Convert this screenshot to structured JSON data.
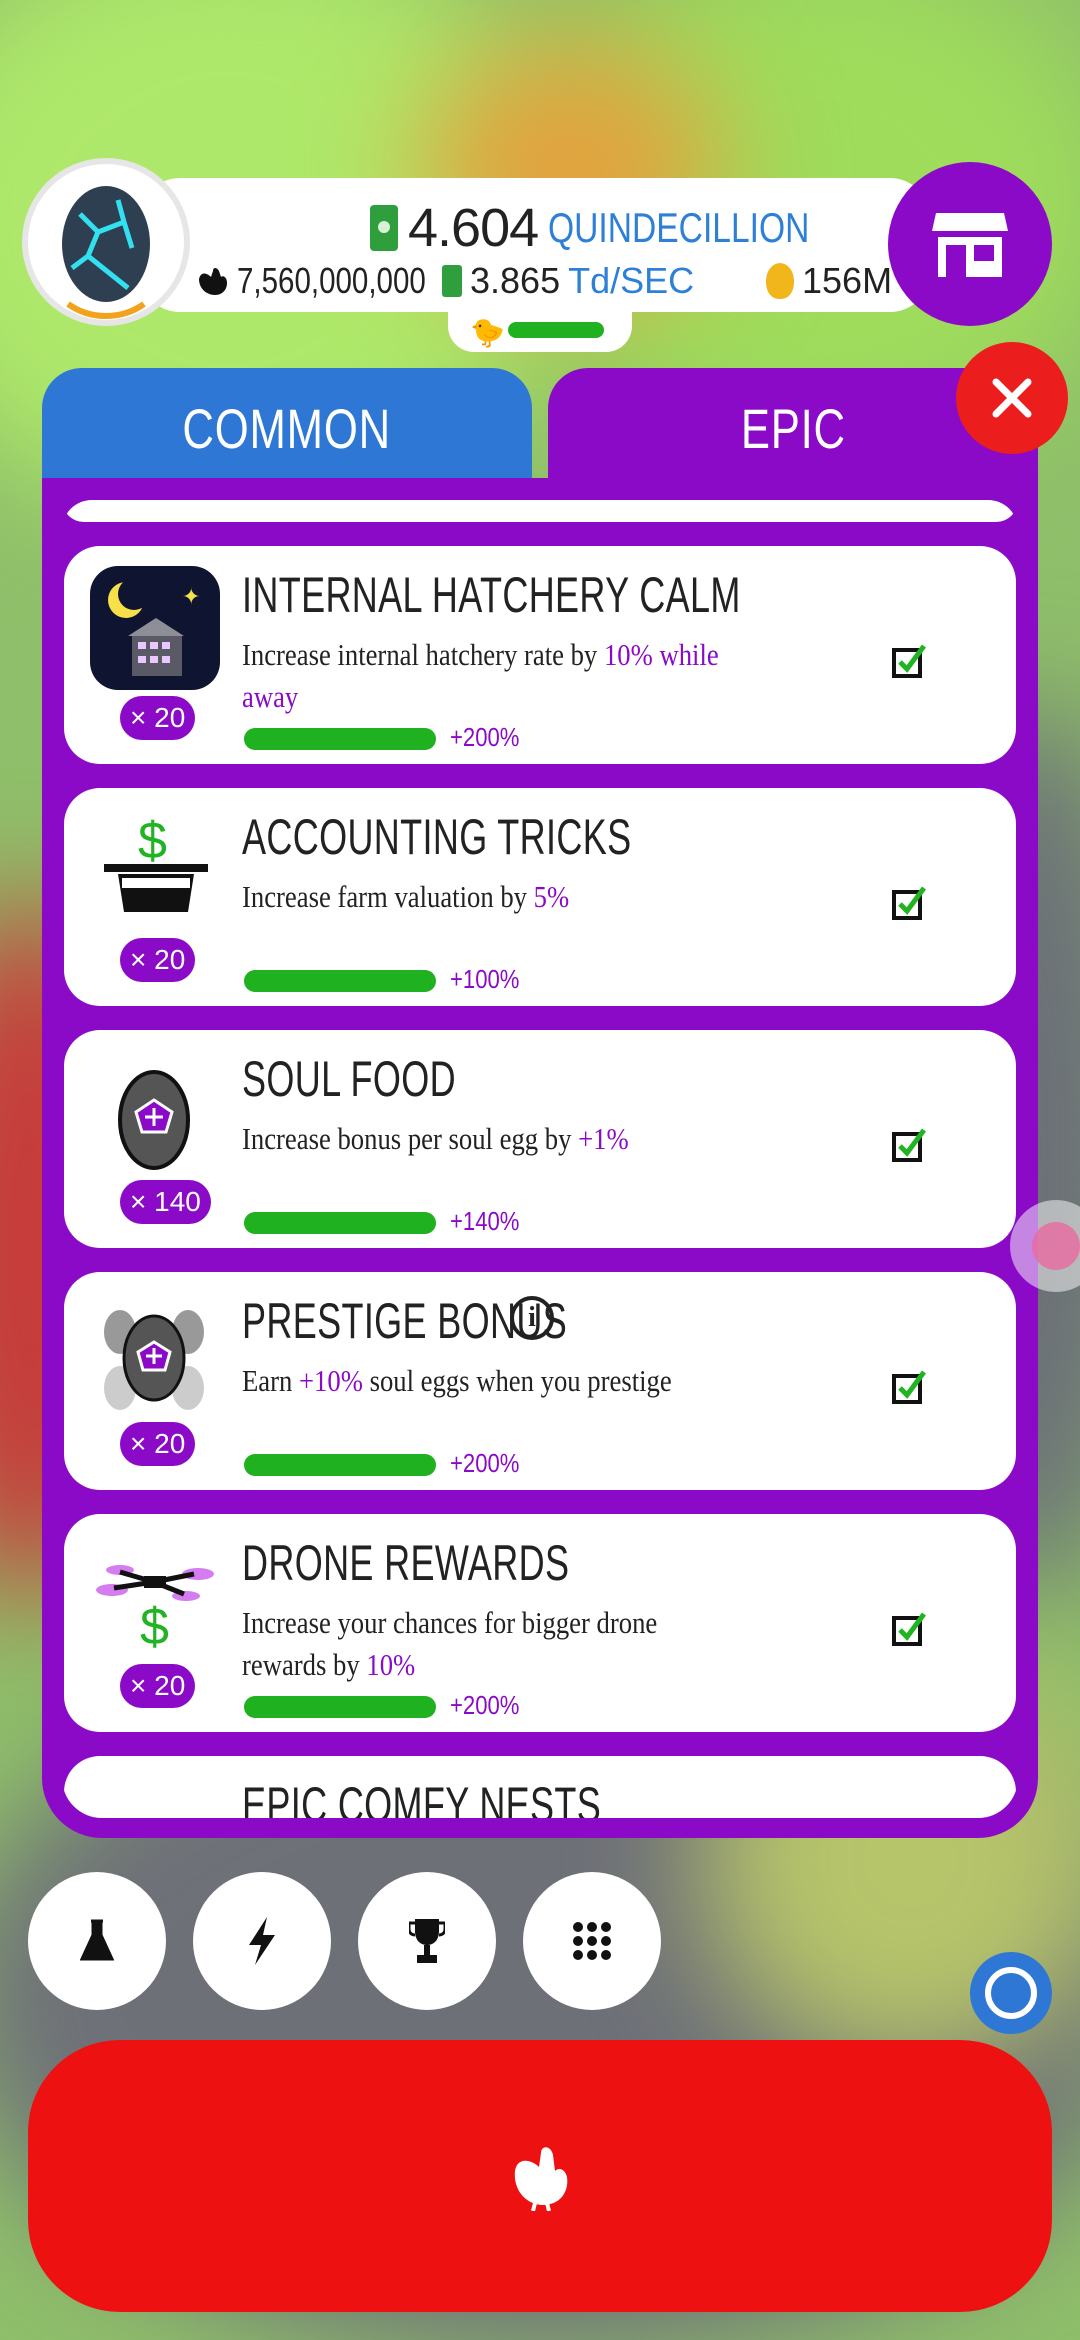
{
  "header": {
    "money_value": "4.604",
    "money_unit": "QUINDECILLION",
    "chicken_count": "7,560,000,000",
    "earning_rate": "3.865",
    "earning_rate_unit": "Td/SEC",
    "golden_eggs": "156M",
    "hatchery_fill": 0.8
  },
  "tabs": [
    {
      "label": "COMMON",
      "color": "#2f77d4"
    },
    {
      "label": "EPIC",
      "color": "#8a0ac7"
    }
  ],
  "research_items": [
    {
      "title": "INTERNAL HATCHERY CALM",
      "desc_prefix": "Increase internal hatchery rate by ",
      "desc_highlight": "10% while away",
      "count": "× 20",
      "bonus": "+200%",
      "purchased": true,
      "icon": "hatchery-night-icon"
    },
    {
      "title": "ACCOUNTING TRICKS",
      "desc_prefix": "Increase farm valuation by ",
      "desc_highlight": "5%",
      "count": "× 20",
      "bonus": "+100%",
      "purchased": true,
      "icon": "top-hat-dollar-icon"
    },
    {
      "title": "SOUL FOOD",
      "desc_prefix": "Increase bonus per soul egg by ",
      "desc_highlight": "+1%",
      "count": "× 140",
      "bonus": "+140%",
      "purchased": true,
      "icon": "soul-egg-icon"
    },
    {
      "title": "PRESTIGE BONUS",
      "desc_prefix": "Earn ",
      "desc_highlight": "+10%",
      "desc_suffix": " soul eggs when you prestige",
      "count": "× 20",
      "bonus": "+200%",
      "purchased": true,
      "icon": "soul-eggs-cluster-icon"
    },
    {
      "title": "DRONE REWARDS",
      "desc_prefix": "Increase your chances for bigger drone rewards by ",
      "desc_highlight": "10%",
      "count": "× 20",
      "bonus": "+200%",
      "purchased": true,
      "icon": "drone-dollar-icon"
    },
    {
      "title": "EPIC COMFY NESTS",
      "icon": "nests-icon"
    }
  ],
  "bottom_nav": [
    "research-flask-icon",
    "boost-lightning-icon",
    "trophy-icon",
    "menu-grid-icon"
  ],
  "colors": {
    "epic_purple": "#8a0ac7",
    "progress_green": "#1fb11f",
    "hatch_red": "#ee1111",
    "close_red": "#ec1d1d"
  }
}
